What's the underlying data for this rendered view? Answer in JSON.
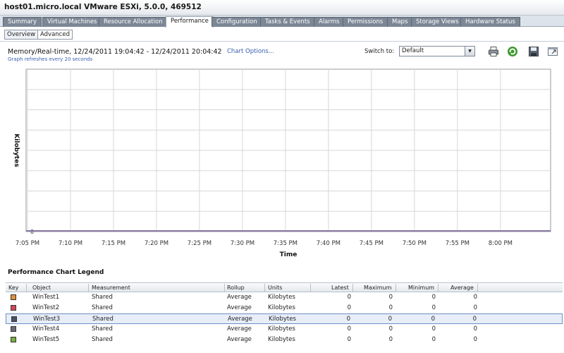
{
  "window": {
    "title": "host01.micro.local VMware ESXi, 5.0.0, 469512"
  },
  "tabs": [
    "Summary",
    "Virtual Machines",
    "Resource Allocation",
    "Performance",
    "Configuration",
    "Tasks & Events",
    "Alarms",
    "Permissions",
    "Maps",
    "Storage Views",
    "Hardware Status"
  ],
  "active_tab": "Performance",
  "subtabs": [
    "Overview",
    "Advanced"
  ],
  "active_subtab": "Advanced",
  "header": {
    "chart_title": "Memory/Real-time, 12/24/2011 19:04:42 - 12/24/2011 20:04:42",
    "chart_options": "Chart Options...",
    "refresh_note": "Graph refreshes every 20 seconds",
    "switch_label": "Switch to:",
    "switch_value": "Default"
  },
  "icons": {
    "print": "printer-icon",
    "refresh": "refresh-icon",
    "save": "save-icon",
    "popout": "popout-icon"
  },
  "colors": {
    "line": "#8a7aa8",
    "grid": "#d7d7d7"
  },
  "chart_data": {
    "type": "line",
    "xlabel": "Time",
    "ylabel": "Kilobytes",
    "x_ticks": [
      "7:05 PM",
      "7:10 PM",
      "7:15 PM",
      "7:20 PM",
      "7:25 PM",
      "7:30 PM",
      "7:35 PM",
      "7:40 PM",
      "7:45 PM",
      "7:50 PM",
      "7:55 PM",
      "8:00 PM"
    ],
    "y_ticks": [
      "0"
    ],
    "series": [
      {
        "name": "WinTest1",
        "color": "#e0903a",
        "values": [
          0,
          0,
          0,
          0,
          0,
          0,
          0,
          0,
          0,
          0,
          0,
          0
        ]
      },
      {
        "name": "WinTest2",
        "color": "#d04858",
        "values": [
          0,
          0,
          0,
          0,
          0,
          0,
          0,
          0,
          0,
          0,
          0,
          0
        ]
      },
      {
        "name": "WinTest3",
        "color": "#4a5068",
        "values": [
          0,
          0,
          0,
          0,
          0,
          0,
          0,
          0,
          0,
          0,
          0,
          0
        ]
      },
      {
        "name": "WinTest4",
        "color": "#6a6a78",
        "values": [
          0,
          0,
          0,
          0,
          0,
          0,
          0,
          0,
          0,
          0,
          0,
          0
        ]
      },
      {
        "name": "WinTest5",
        "color": "#78b040",
        "values": [
          0,
          0,
          0,
          0,
          0,
          0,
          0,
          0,
          0,
          0,
          0,
          0
        ]
      }
    ]
  },
  "legend": {
    "title": "Performance Chart Legend",
    "columns": [
      "Key",
      "Object",
      "Measurement",
      "Rollup",
      "Units",
      "Latest",
      "Maximum",
      "Minimum",
      "Average"
    ],
    "rows": [
      {
        "color": "#e0903a",
        "object": "WinTest1",
        "measurement": "Shared",
        "rollup": "Average",
        "units": "Kilobytes",
        "latest": "0",
        "maximum": "0",
        "minimum": "0",
        "average": "0"
      },
      {
        "color": "#d04858",
        "object": "WinTest2",
        "measurement": "Shared",
        "rollup": "Average",
        "units": "Kilobytes",
        "latest": "0",
        "maximum": "0",
        "minimum": "0",
        "average": "0"
      },
      {
        "color": "#4a5068",
        "object": "WinTest3",
        "measurement": "Shared",
        "rollup": "Average",
        "units": "Kilobytes",
        "latest": "0",
        "maximum": "0",
        "minimum": "0",
        "average": "0"
      },
      {
        "color": "#6a6a78",
        "object": "WinTest4",
        "measurement": "Shared",
        "rollup": "Average",
        "units": "Kilobytes",
        "latest": "0",
        "maximum": "0",
        "minimum": "0",
        "average": "0"
      },
      {
        "color": "#78b040",
        "object": "WinTest5",
        "measurement": "Shared",
        "rollup": "Average",
        "units": "Kilobytes",
        "latest": "0",
        "maximum": "0",
        "minimum": "0",
        "average": "0"
      }
    ],
    "selected_row": 2
  }
}
